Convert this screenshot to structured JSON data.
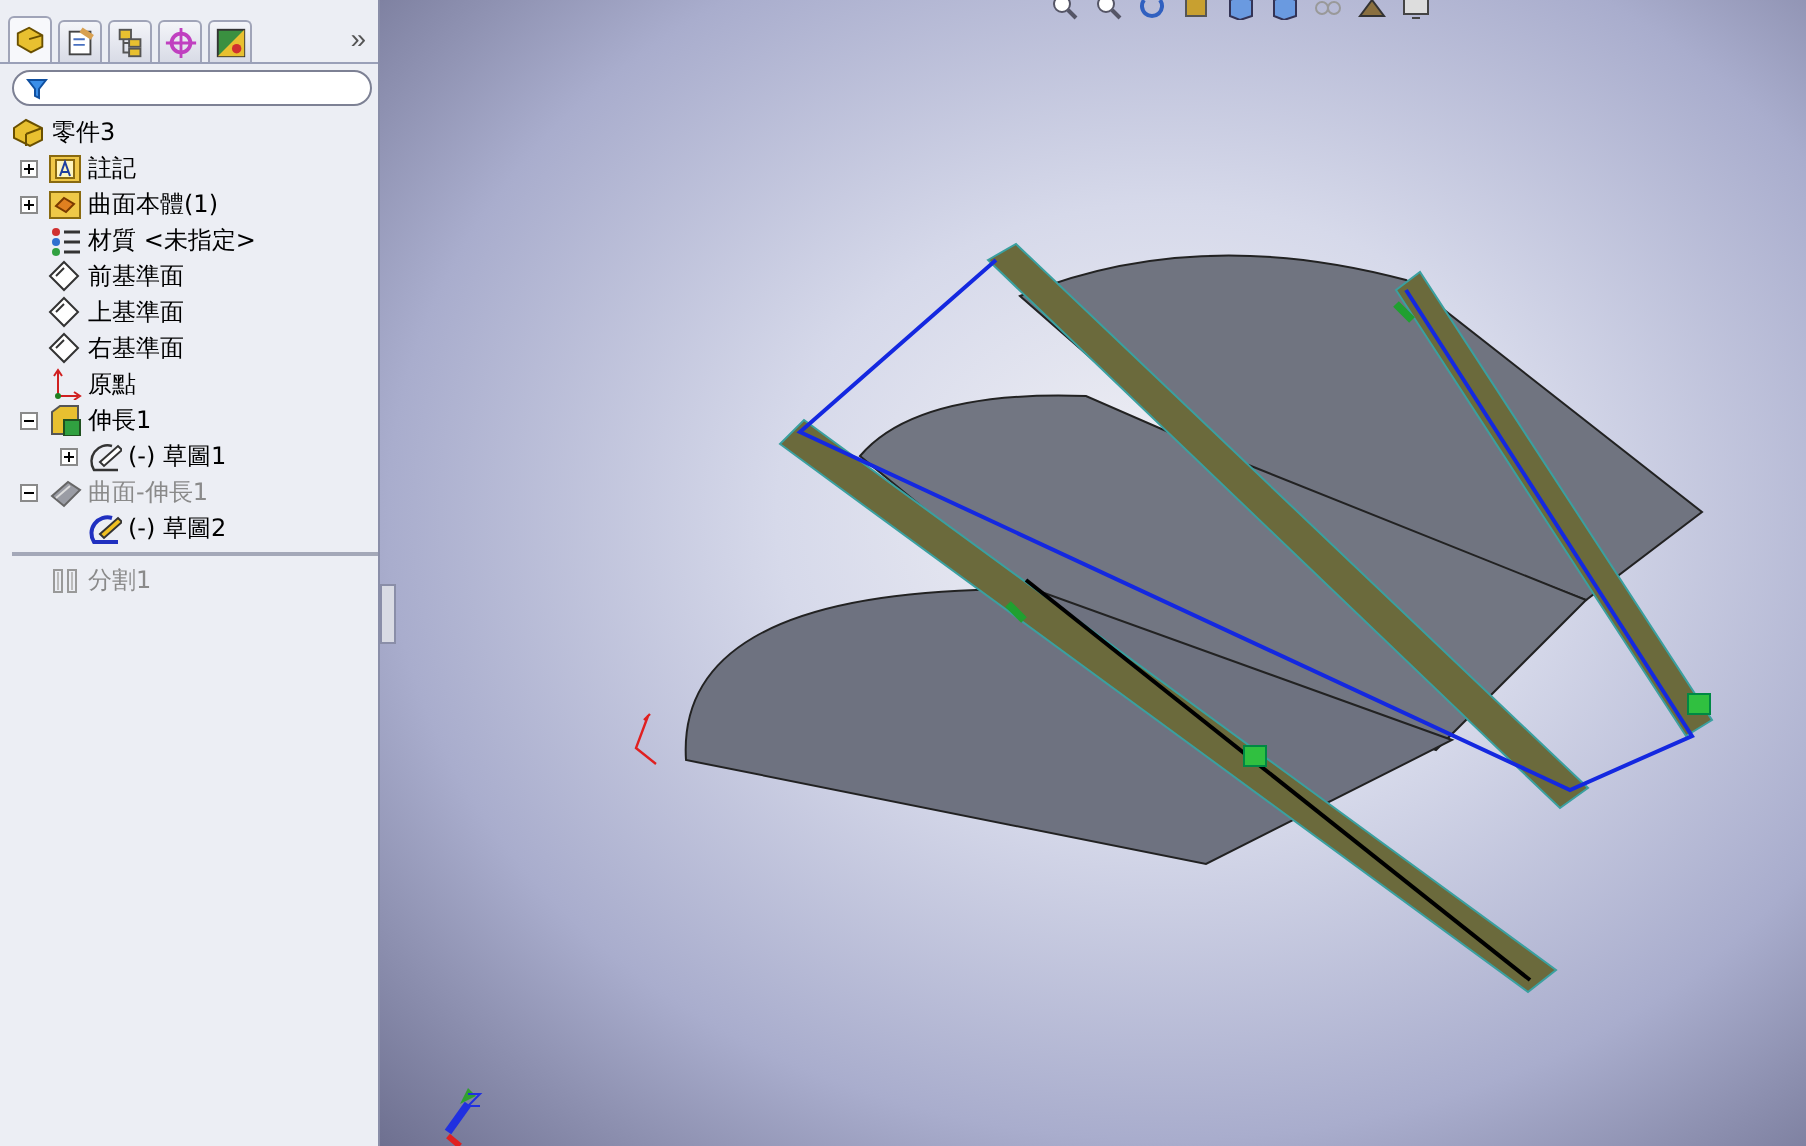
{
  "panel": {
    "tabs": [
      {
        "kind": "feature-tree",
        "selected": true
      },
      {
        "kind": "property",
        "selected": false
      },
      {
        "kind": "configuration",
        "selected": false
      },
      {
        "kind": "dimxpert",
        "selected": false
      },
      {
        "kind": "display",
        "selected": false
      }
    ],
    "more": "»",
    "tree": [
      {
        "label": "零件3",
        "kind": "part",
        "dimmed": false,
        "children": [
          {
            "label": "註記",
            "kind": "annotation-folder",
            "expanded": false,
            "dimmed": false
          },
          {
            "label": "曲面本體(1)",
            "kind": "body-folder",
            "expanded": false,
            "dimmed": false
          },
          {
            "label": "材質 <未指定>",
            "kind": "material",
            "dimmed": false
          },
          {
            "label": "前基準面",
            "kind": "plane",
            "dimmed": false
          },
          {
            "label": "上基準面",
            "kind": "plane",
            "dimmed": false
          },
          {
            "label": "右基準面",
            "kind": "plane",
            "dimmed": false
          },
          {
            "label": "原點",
            "kind": "origin",
            "dimmed": false
          },
          {
            "label": "伸長1",
            "kind": "extrude",
            "expanded": true,
            "dimmed": false,
            "children": [
              {
                "label": "(-) 草圖1",
                "kind": "sketch",
                "expanded": false,
                "dimmed": false
              }
            ]
          },
          {
            "label": "曲面-伸長1",
            "kind": "surface",
            "expanded": true,
            "dimmed": true,
            "children": [
              {
                "label": "(-) 草圖2",
                "kind": "sketch-edit",
                "dimmed": false
              }
            ]
          },
          {
            "kind": "rollback"
          },
          {
            "label": "分割1",
            "kind": "split",
            "dimmed": true
          }
        ]
      }
    ]
  }
}
